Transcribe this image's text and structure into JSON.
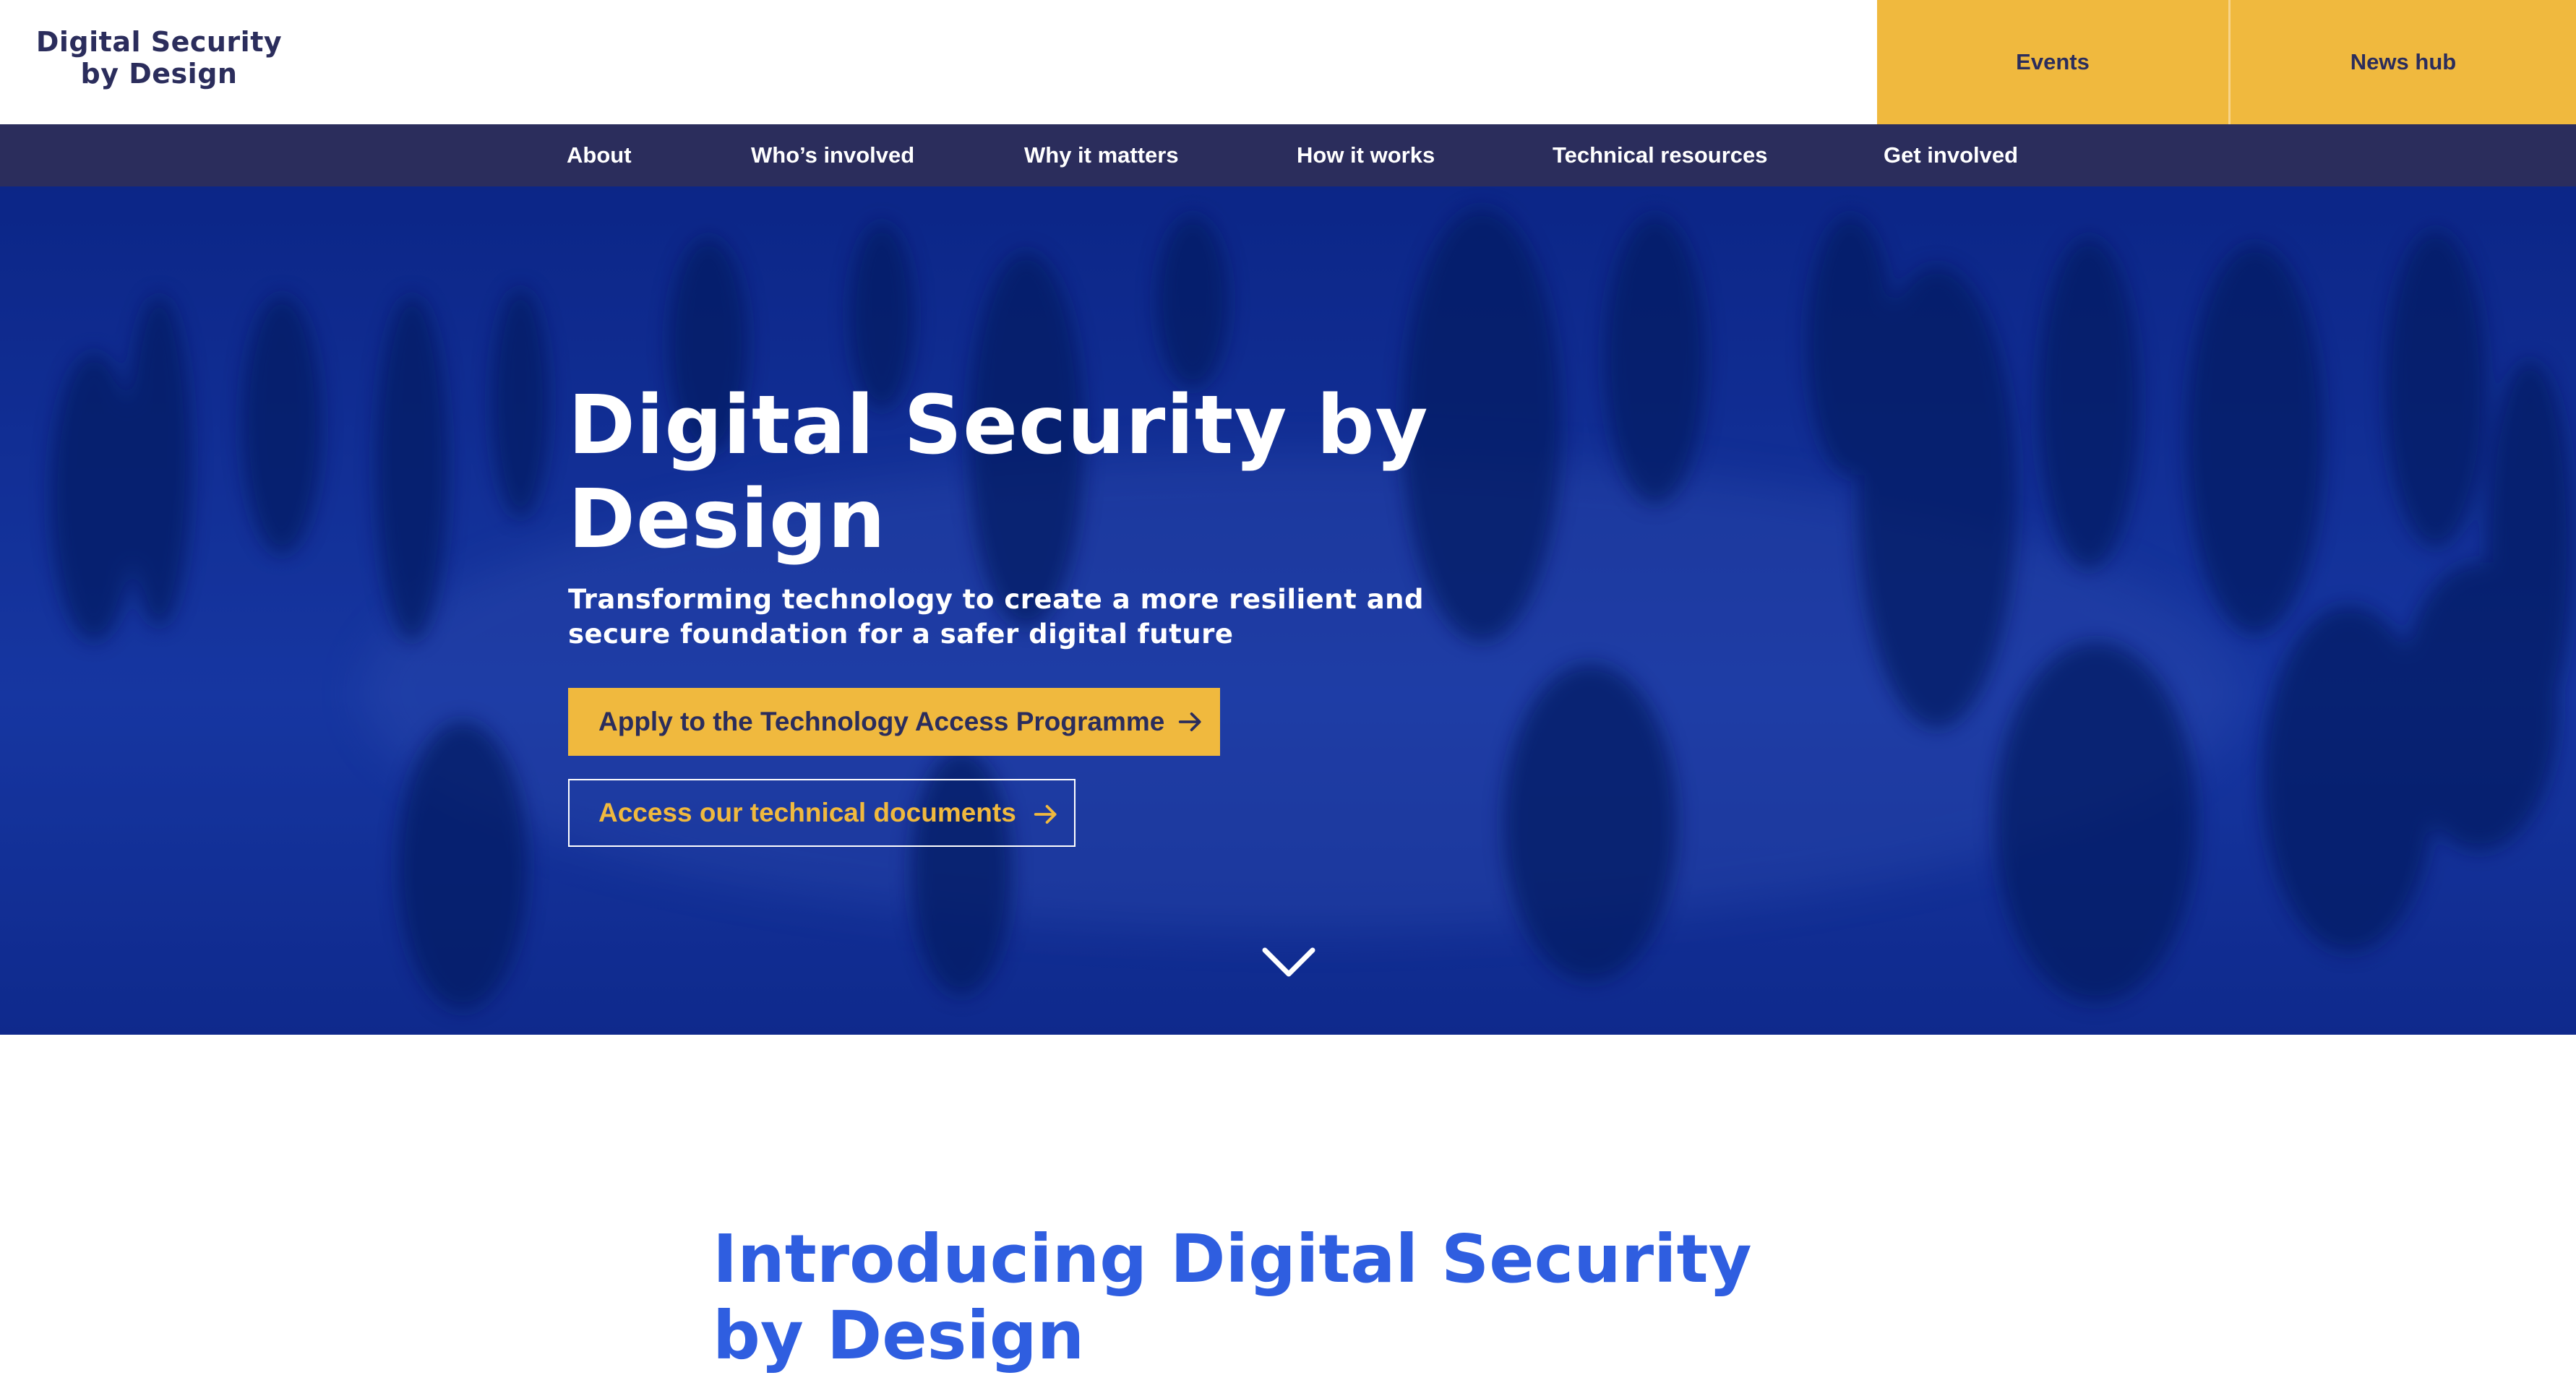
{
  "header": {
    "logo_line1": "Digital Security",
    "logo_line2": "by Design",
    "top_links": [
      "Events",
      "News hub"
    ]
  },
  "nav": {
    "items": [
      "About",
      "Who’s involved",
      "Why it matters",
      "How it works",
      "Technical resources",
      "Get involved"
    ]
  },
  "hero": {
    "title": "Digital Security by Design",
    "subtitle": "Transforming technology to create a more resilient and secure foundation for a safer digital future",
    "primary_cta": "Apply to the Technology Access Programme",
    "secondary_cta": "Access our technical documents",
    "primary_cta_icon": "arrow-right-icon",
    "secondary_cta_icon": "arrow-right-icon",
    "scroll_icon": "chevron-down-icon"
  },
  "intro": {
    "title": "Introducing Digital Security by Design"
  },
  "colors": {
    "navy": "#2b2d5c",
    "accent_yellow": "#f0b93e",
    "hero_blue": "#0f2b8f",
    "heading_blue": "#2f5ee0"
  }
}
